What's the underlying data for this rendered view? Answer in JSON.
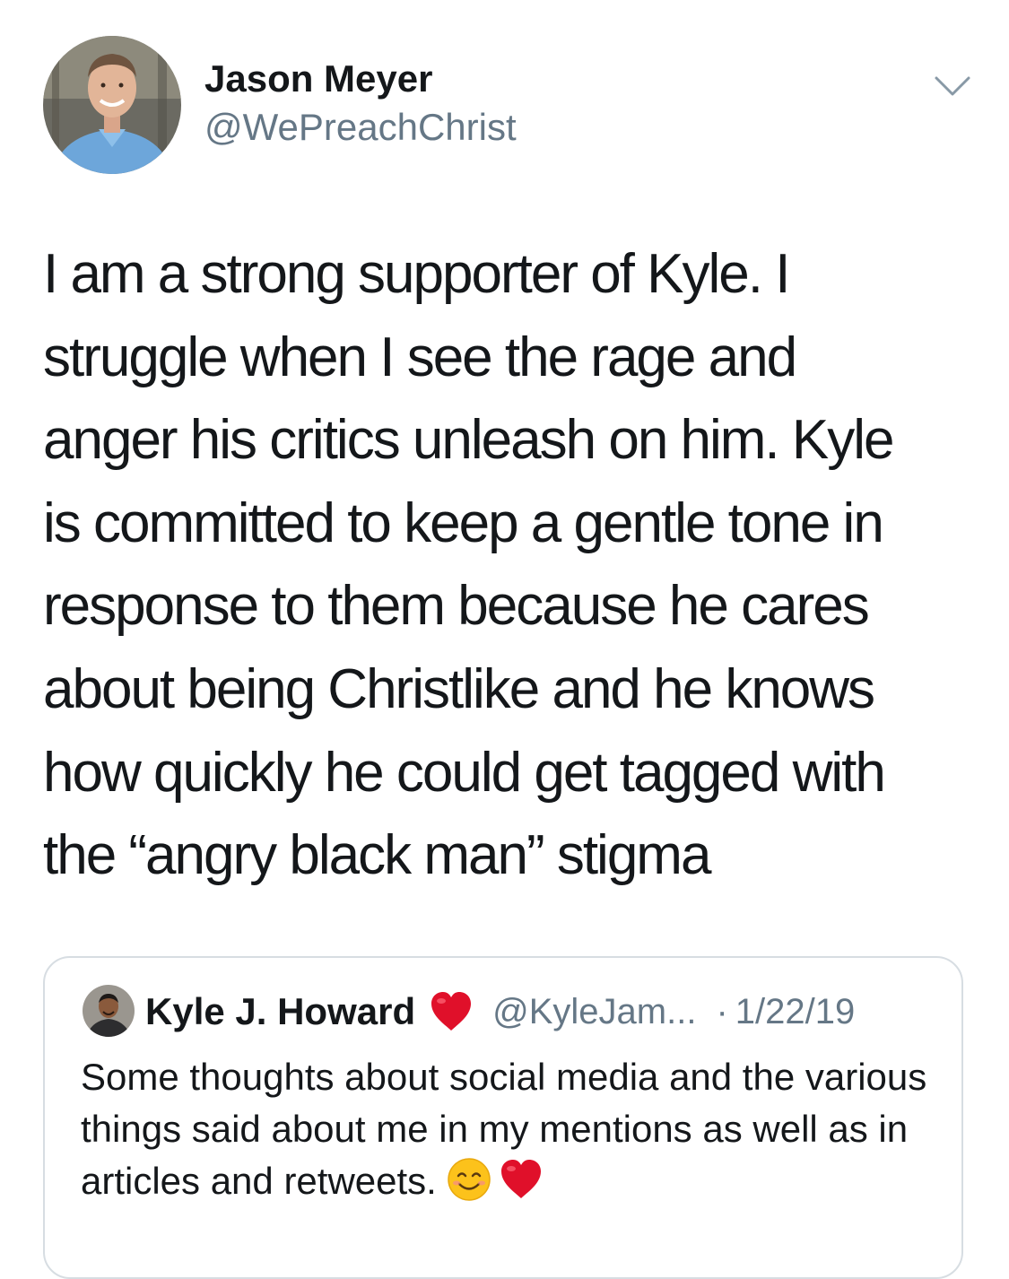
{
  "tweet": {
    "author": {
      "name": "Jason Meyer",
      "handle": "@WePreachChrist"
    },
    "text": "I am a strong supporter of Kyle. I\nstruggle when I see the rage and\nanger his critics unleash on him. Kyle\nis committed to keep a gentle tone in\nresponse to them because he cares\nabout being Christlike and he knows\nhow quickly he could get tagged with\nthe “angry black man” stigma",
    "menu_icon": "chevron-down-icon"
  },
  "quoted_tweet": {
    "author": {
      "name": "Kyle J. Howard",
      "handle": "@KyleJam...",
      "name_badge_icon": "red-heart-icon"
    },
    "separator": "·",
    "date": "1/22/19",
    "text": "Some thoughts about social media and the various things said about me in my mentions as well as in articles and retweets.",
    "trailing_icons": [
      "smiling-face-icon",
      "red-heart-icon"
    ]
  },
  "colors": {
    "text_primary": "#14171a",
    "text_secondary": "#657786",
    "border": "#d7dde2",
    "heart": "#e0102a"
  }
}
